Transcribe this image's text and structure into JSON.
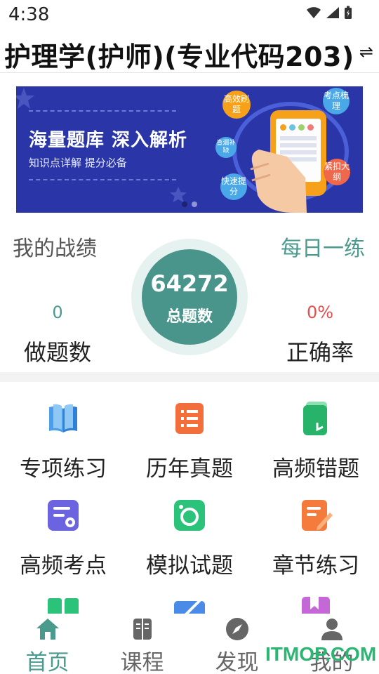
{
  "status_bar": {
    "time": "4:38",
    "icons": [
      "wifi-icon",
      "signal-icon",
      "battery-icon"
    ]
  },
  "header": {
    "title": "护理学(护师)(专业代码203)",
    "switch_icon": "swap-icon"
  },
  "banner": {
    "headline": "海量题库 深入解析",
    "subline": "知识点详解 提分必备",
    "bubbles": [
      "高效刷题",
      "考点梳理",
      "查漏补缺",
      "快速提分",
      "紧扣大纲"
    ]
  },
  "stats": {
    "title": "我的战绩",
    "daily_link": "每日一练",
    "done_value": "0",
    "done_label": "做题数",
    "total_value": "64272",
    "total_label": "总题数",
    "accuracy_value": "0%",
    "accuracy_label": "正确率"
  },
  "grid": [
    {
      "label": "专项练习",
      "icon": "open-book-icon"
    },
    {
      "label": "历年真题",
      "icon": "list-document-icon"
    },
    {
      "label": "高频错题",
      "icon": "notebook-icon"
    },
    {
      "label": "高频考点",
      "icon": "doc-gear-icon"
    },
    {
      "label": "模拟试题",
      "icon": "camera-icon"
    },
    {
      "label": "章节练习",
      "icon": "edit-document-icon"
    },
    {
      "label": "",
      "icon": "book-icon"
    },
    {
      "label": "",
      "icon": "pen-card-icon"
    },
    {
      "label": "",
      "icon": "bookmark-icon"
    }
  ],
  "bottom_nav": [
    {
      "label": "首页",
      "icon": "home-icon",
      "active": true
    },
    {
      "label": "课程",
      "icon": "course-book-icon",
      "active": false
    },
    {
      "label": "发现",
      "icon": "compass-icon",
      "active": false
    },
    {
      "label": "我的",
      "icon": "user-icon",
      "active": false
    }
  ],
  "watermark": "ITMOP.COM",
  "colors": {
    "accent": "#4a958b",
    "banner": "#2a36a8",
    "accuracy": "#e05050",
    "done": "#4a9a8e"
  }
}
